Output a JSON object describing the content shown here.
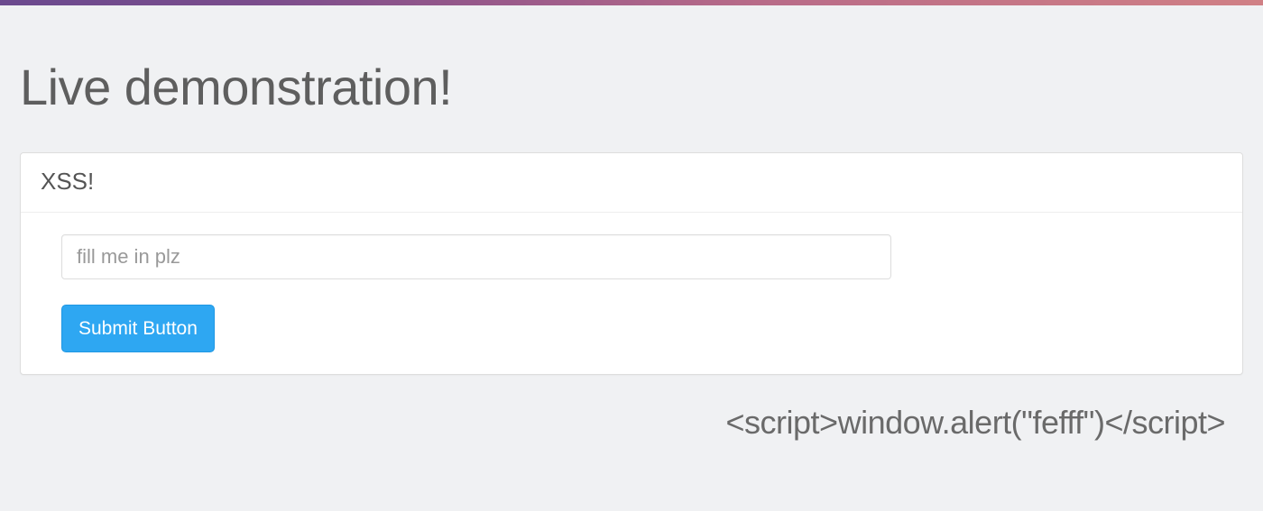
{
  "header": {
    "title": "Live demonstration!"
  },
  "panel": {
    "title": "XSS!",
    "input_placeholder": "fill me in plz",
    "submit_label": "Submit Button"
  },
  "output": {
    "text": "<script>window.alert(\"fefff\")</script>"
  },
  "colors": {
    "background": "#f0f1f3",
    "panel_bg": "#ffffff",
    "primary_button": "#2ea7f2",
    "gradient_start": "#6b4a8e",
    "gradient_end": "#d08085"
  }
}
